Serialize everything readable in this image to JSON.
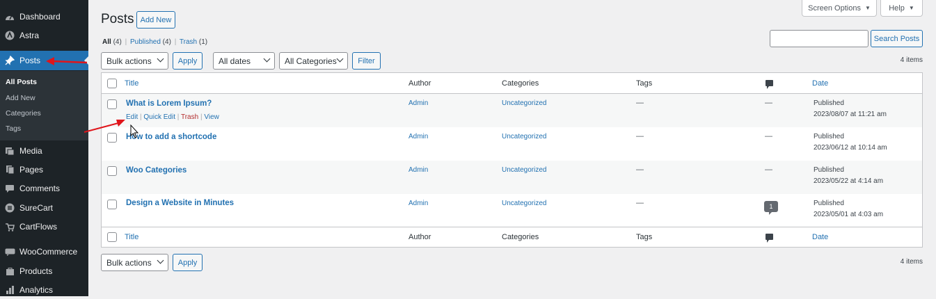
{
  "sidebar": {
    "items": [
      {
        "label": "Dashboard",
        "icon": "dashboard-icon"
      },
      {
        "label": "Astra",
        "icon": "astra-icon"
      },
      {
        "label": "Posts",
        "icon": "pin-icon"
      },
      {
        "label": "Media",
        "icon": "media-icon"
      },
      {
        "label": "Pages",
        "icon": "pages-icon"
      },
      {
        "label": "Comments",
        "icon": "comment-icon"
      },
      {
        "label": "SureCart",
        "icon": "surecart-icon"
      },
      {
        "label": "CartFlows",
        "icon": "cartflows-icon"
      },
      {
        "label": "WooCommerce",
        "icon": "woo-icon"
      },
      {
        "label": "Products",
        "icon": "products-icon"
      },
      {
        "label": "Analytics",
        "icon": "analytics-icon"
      }
    ],
    "submenu": [
      "All Posts",
      "Add New",
      "Categories",
      "Tags"
    ]
  },
  "header": {
    "title": "Posts",
    "add_new": "Add New",
    "screen_options": "Screen Options",
    "help": "Help"
  },
  "filters": {
    "all": "All",
    "all_count": "(4)",
    "published": "Published",
    "published_count": "(4)",
    "trash": "Trash",
    "trash_count": "(1)",
    "sep": "|"
  },
  "search": {
    "value": "",
    "button": "Search Posts"
  },
  "bulk": {
    "selected": "Bulk actions",
    "apply": "Apply"
  },
  "dates": {
    "selected": "All dates"
  },
  "categories": {
    "selected": "All Categories"
  },
  "filter_button": "Filter",
  "items_count": "4 items",
  "columns": {
    "title": "Title",
    "author": "Author",
    "categories": "Categories",
    "tags": "Tags",
    "date": "Date"
  },
  "rows": [
    {
      "title": "What is Lorem Ipsum?",
      "author": "Admin",
      "category": "Uncategorized",
      "tags": "—",
      "comments": "—",
      "status": "Published",
      "date": "2023/08/07 at 11:21 am"
    },
    {
      "title": "How to add a shortcode",
      "author": "Admin",
      "category": "Uncategorized",
      "tags": "—",
      "comments": "—",
      "status": "Published",
      "date": "2023/06/12 at 10:14 am"
    },
    {
      "title": "Woo Categories",
      "author": "Admin",
      "category": "Uncategorized",
      "tags": "—",
      "comments": "—",
      "status": "Published",
      "date": "2023/05/22 at 4:14 am"
    },
    {
      "title": "Design a Website in Minutes",
      "author": "Admin",
      "category": "Uncategorized",
      "tags": "—",
      "comments": "1",
      "status": "Published",
      "date": "2023/05/01 at 4:03 am"
    }
  ],
  "row_actions": {
    "edit": "Edit",
    "quick_edit": "Quick Edit",
    "trash": "Trash",
    "view": "View",
    "sep": "|"
  },
  "colors": {
    "accent": "#2271b1",
    "sidebar": "#1d2327",
    "annotation": "#e0151b",
    "trash": "#b32d2e"
  }
}
